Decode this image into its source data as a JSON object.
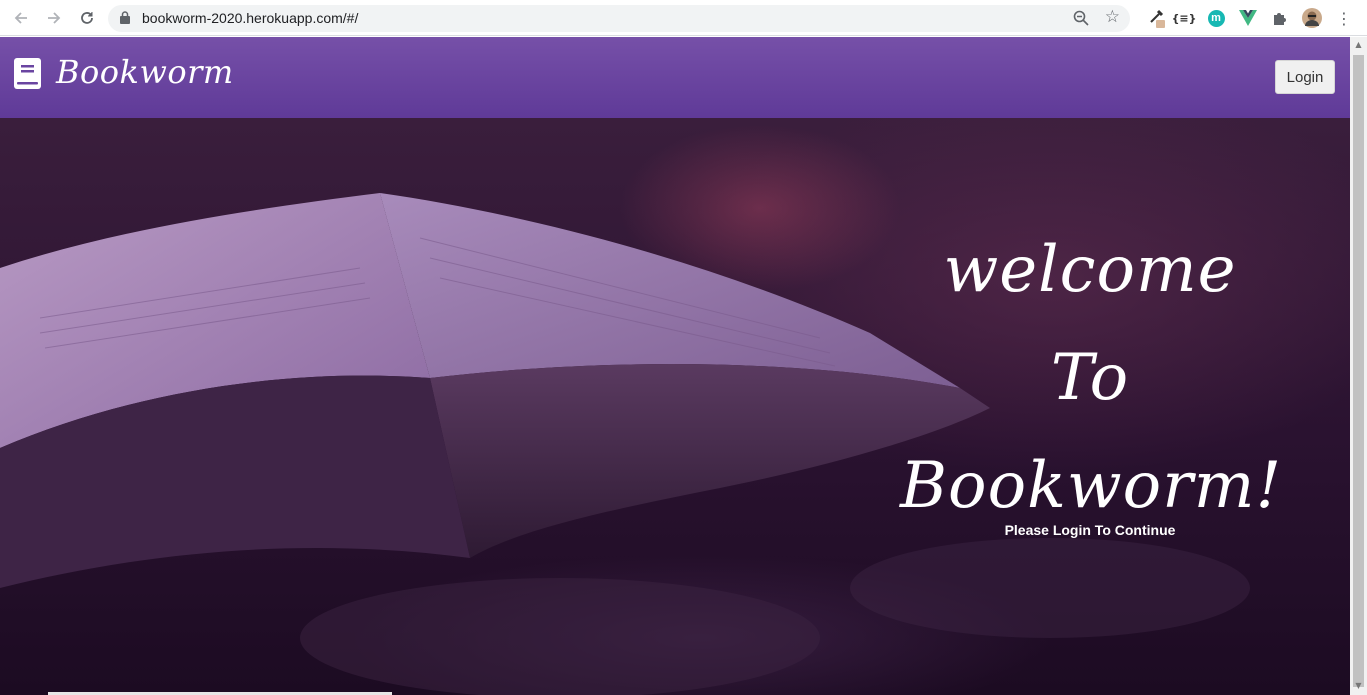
{
  "browser": {
    "url": "bookworm-2020.herokuapp.com/#/",
    "nav_icons": [
      "back-arrow-icon",
      "forward-arrow-icon",
      "reload-icon"
    ],
    "extension_icons": [
      "eyedropper-icon",
      "json-formatter-icon",
      "m-extension-icon",
      "vue-devtools-icon",
      "puzzle-extensions-icon",
      "profile-avatar-icon",
      "kebab-menu-icon"
    ],
    "extension_label": "{≡}",
    "extension_m": "m"
  },
  "navbar": {
    "brand": "Bookworm",
    "login_label": "Login",
    "background_color": "#6a45a1"
  },
  "hero": {
    "lines": [
      "welcome",
      "To",
      "Bookworm!"
    ],
    "subtitle": "Please Login To Continue"
  }
}
